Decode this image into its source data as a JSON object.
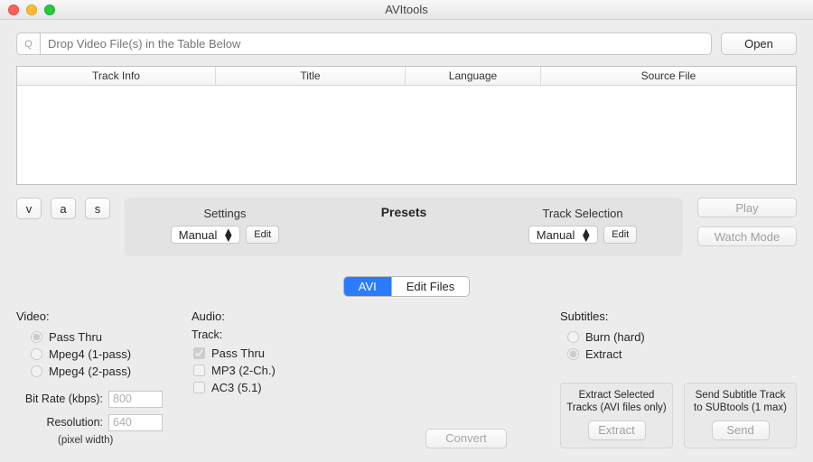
{
  "window": {
    "title": "AVItools"
  },
  "top": {
    "search_placeholder": "Drop Video File(s) in the Table Below",
    "q_label": "Q",
    "open_label": "Open"
  },
  "table": {
    "columns": [
      "Track Info",
      "Title",
      "Language",
      "Source File"
    ]
  },
  "vas": {
    "v": "v",
    "a": "a",
    "s": "s"
  },
  "presets": {
    "title": "Presets",
    "settings_label": "Settings",
    "track_label": "Track Selection",
    "settings_value": "Manual",
    "track_value": "Manual",
    "edit_label": "Edit"
  },
  "right": {
    "play_label": "Play",
    "watch_label": "Watch Mode"
  },
  "tabs": {
    "avi": "AVI",
    "edit": "Edit Files"
  },
  "video": {
    "heading": "Video:",
    "opt1": "Pass Thru",
    "opt2": "Mpeg4 (1-pass)",
    "opt3": "Mpeg4 (2-pass)",
    "bitrate_label": "Bit Rate (kbps):",
    "bitrate_value": "800",
    "resolution_label": "Resolution:",
    "resolution_value": "640",
    "resolution_note": "(pixel width)"
  },
  "audio": {
    "heading": "Audio:",
    "track_label": "Track:",
    "opt1": "Pass Thru",
    "opt2": "MP3 (2-Ch.)",
    "opt3": "AC3 (5.1)"
  },
  "convert": {
    "label": "Convert"
  },
  "subtitles": {
    "heading": "Subtitles:",
    "opt1": "Burn (hard)",
    "opt2": "Extract",
    "box1_label": "Extract Selected Tracks (AVI files only)",
    "box1_btn": "Extract",
    "box2_label": "Send Subtitle Track to SUBtools (1 max)",
    "box2_btn": "Send"
  }
}
